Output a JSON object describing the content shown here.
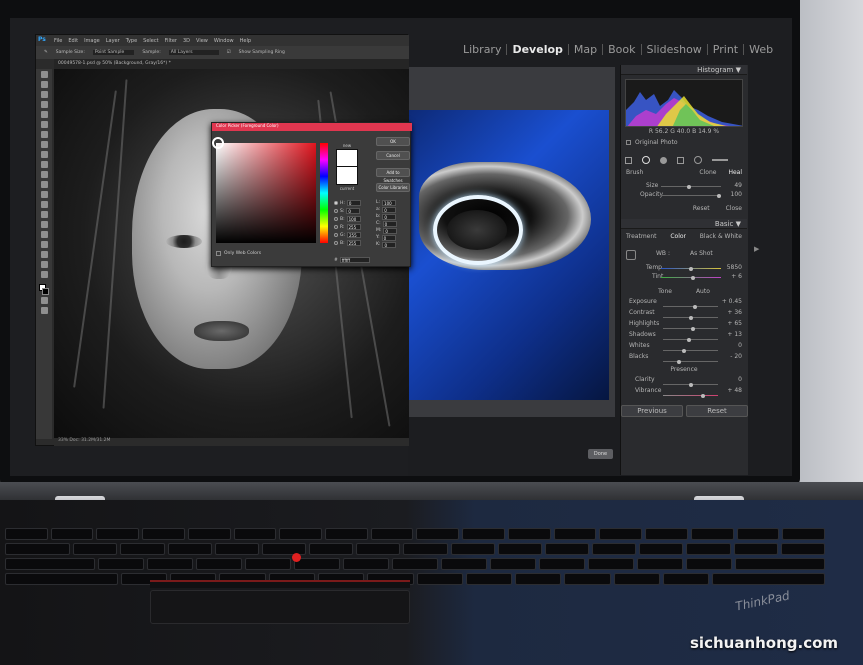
{
  "photoshop": {
    "logo": "Ps",
    "menu": [
      "File",
      "Edit",
      "Image",
      "Layer",
      "Type",
      "Select",
      "Filter",
      "3D",
      "View",
      "Window",
      "Help"
    ],
    "options": {
      "sample_size_label": "Sample Size:",
      "sample_size_value": "Point Sample",
      "sample_label": "Sample:",
      "sample_value": "All Layers",
      "show_ring": "Show Sampling Ring"
    },
    "doc_tab": "00049578-1.psd @ 50% (Background, Gray/16*) *",
    "status": "33%    Doc: 31.2M/31.2M"
  },
  "color_picker": {
    "title": "Color Picker (Foreground Color)",
    "new_label": "new",
    "current_label": "current",
    "buttons": {
      "ok": "OK",
      "cancel": "Cancel",
      "add": "Add to Swatches",
      "libraries": "Color Libraries"
    },
    "fields": [
      {
        "label": "H:",
        "value": "0"
      },
      {
        "label": "S:",
        "value": "0"
      },
      {
        "label": "B:",
        "value": "100"
      },
      {
        "label": "R:",
        "value": "255"
      },
      {
        "label": "G:",
        "value": "255"
      },
      {
        "label": "B:",
        "value": "255"
      }
    ],
    "lab": [
      {
        "label": "L:",
        "value": "100"
      },
      {
        "label": "a:",
        "value": "0"
      },
      {
        "label": "b:",
        "value": "0"
      },
      {
        "label": "C:",
        "value": "0"
      },
      {
        "label": "M:",
        "value": "0"
      },
      {
        "label": "Y:",
        "value": "0"
      },
      {
        "label": "K:",
        "value": "0"
      }
    ],
    "web_only": "Only Web Colors",
    "hex_label": "#",
    "hex_value": "ffffff"
  },
  "lightroom": {
    "modules": [
      "Library",
      "Develop",
      "Map",
      "Book",
      "Slideshow",
      "Print",
      "Web"
    ],
    "active_module": "Develop",
    "done": "Done",
    "histogram": {
      "header": "Histogram",
      "readout": "R  56.2  G  40.0  B  14.9  %",
      "original_photo": "Original Photo"
    },
    "brush": {
      "label": "Brush",
      "clone": "Clone",
      "heal": "Heal",
      "size_label": "Size",
      "size_value": "49",
      "opacity_label": "Opacity",
      "opacity_value": "100",
      "reset": "Reset",
      "close": "Close"
    },
    "basic": {
      "header": "Basic",
      "treatment_label": "Treatment",
      "treatment_color": "Color",
      "treatment_bw": "Black & White",
      "wb_label": "WB :",
      "wb_value": "As Shot",
      "temp_label": "Temp",
      "temp_value": "5850",
      "tint_label": "Tint",
      "tint_value": "+ 6",
      "tone_label": "Tone",
      "tone_auto": "Auto",
      "tone": [
        {
          "label": "Exposure",
          "value": "+ 0.45"
        },
        {
          "label": "Contrast",
          "value": "+ 36"
        },
        {
          "label": "Highlights",
          "value": "+ 65"
        },
        {
          "label": "Shadows",
          "value": "+ 13"
        },
        {
          "label": "Whites",
          "value": "0"
        },
        {
          "label": "Blacks",
          "value": "- 20"
        }
      ],
      "presence_label": "Presence",
      "presence": [
        {
          "label": "Clarity",
          "value": "0"
        },
        {
          "label": "Vibrance",
          "value": "+ 48"
        }
      ]
    },
    "buttons": {
      "previous": "Previous",
      "reset": "Reset"
    }
  },
  "device": {
    "brand": "ThinkPad"
  },
  "watermark": "sichuanhong.com"
}
